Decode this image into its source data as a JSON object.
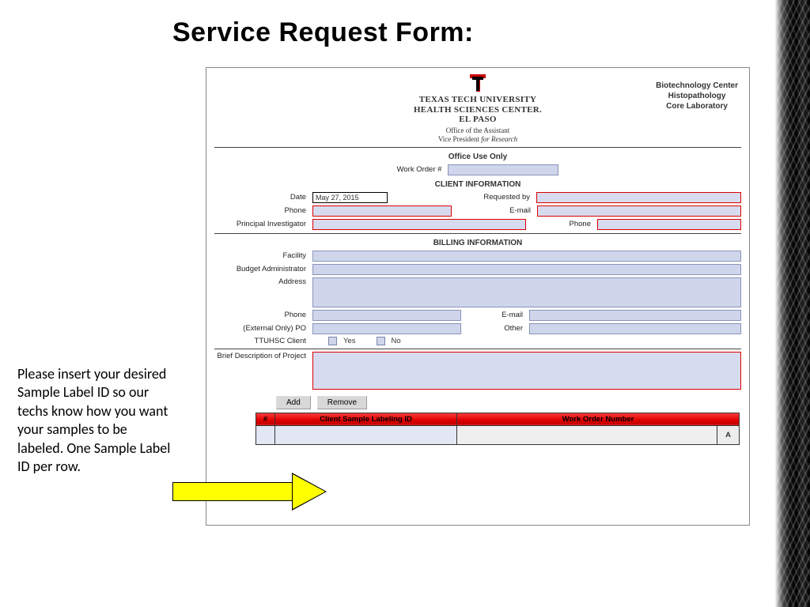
{
  "title": "Service Request Form:",
  "header": {
    "uni_line1": "TEXAS TECH UNIVERSITY",
    "uni_line2": "HEALTH SCIENCES CENTER.",
    "uni_line3": "EL PASO",
    "sub1": "Office of the Assistant",
    "sub2_a": "Vice President ",
    "sub2_b": "for Research",
    "dept1": "Biotechnology Center",
    "dept2": "Histopathology",
    "dept3": "Core Laboratory"
  },
  "office_use": {
    "heading": "Office Use Only",
    "work_order_label": "Work Order #"
  },
  "client": {
    "heading": "CLIENT INFORMATION",
    "date_label": "Date",
    "date_value": "May 27, 2015",
    "requested_by": "Requested by",
    "phone": "Phone",
    "email": "E-mail",
    "pi": "Principal Investigator",
    "pi_phone": "Phone"
  },
  "billing": {
    "heading": "BILLING INFORMATION",
    "facility": "Facility",
    "budget_admin": "Budget Administrator",
    "address": "Address",
    "phone": "Phone",
    "email": "E-mail",
    "ext_po": "(External Only) PO",
    "other": "Other",
    "client_label": "TTUHSC Client",
    "yes": "Yes",
    "no": "No"
  },
  "project": {
    "label": "Brief Description of Project"
  },
  "buttons": {
    "add": "Add",
    "remove": "Remove"
  },
  "table": {
    "col_num": "#",
    "col_sample": "Client Sample Labeling ID",
    "col_wo": "Work Order Number",
    "row_a": "A"
  },
  "note": "Please insert your desired Sample Label ID so our techs know how you want your samples to be labeled. One Sample Label ID per row."
}
